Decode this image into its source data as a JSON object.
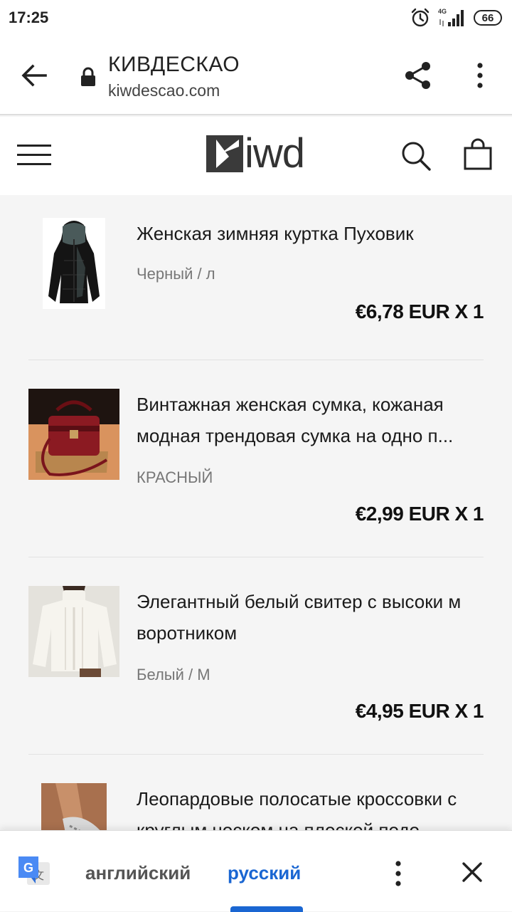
{
  "status_bar": {
    "time": "17:25",
    "network_label": "4G",
    "battery": "66",
    "icons": [
      "alarm-icon",
      "signal-icon",
      "battery-icon"
    ]
  },
  "tab_bar": {
    "title": "КИВДЕСКАО",
    "url": "kiwdescao.com",
    "icons": [
      "back-arrow-icon",
      "lock-icon",
      "share-icon",
      "more-vert-icon"
    ]
  },
  "site_header": {
    "logo_text": "iwd",
    "icons": [
      "hamburger-menu-icon",
      "kiwd-logo-mark",
      "search-icon",
      "shopping-bag-icon"
    ]
  },
  "items": [
    {
      "title": "Женская зимняя куртка Пуховик",
      "variant": "Черный / л",
      "price": "€6,78 EUR X 1",
      "image": "black-hooded-winter-jacket"
    },
    {
      "title": "Винтажная женская сумка, кожаная модная трендовая сумка на одно п...",
      "variant": "КРАСНЫЙ",
      "price": "€2,99 EUR X 1",
      "image": "red-leather-handbag"
    },
    {
      "title": "Элегантный белый свитер с высоки м воротником",
      "variant": "Белый / М",
      "price": "€4,95 EUR X 1",
      "image": "white-turtleneck-sweater"
    },
    {
      "title": "Леопардовые полосатые кроссовки с круглым носком на плоской подо",
      "variant": "",
      "price": "",
      "image": "leopard-sneakers"
    }
  ],
  "translate_bar": {
    "source_lang": "английский",
    "target_lang": "русский",
    "accent_color": "#1a66d2"
  }
}
